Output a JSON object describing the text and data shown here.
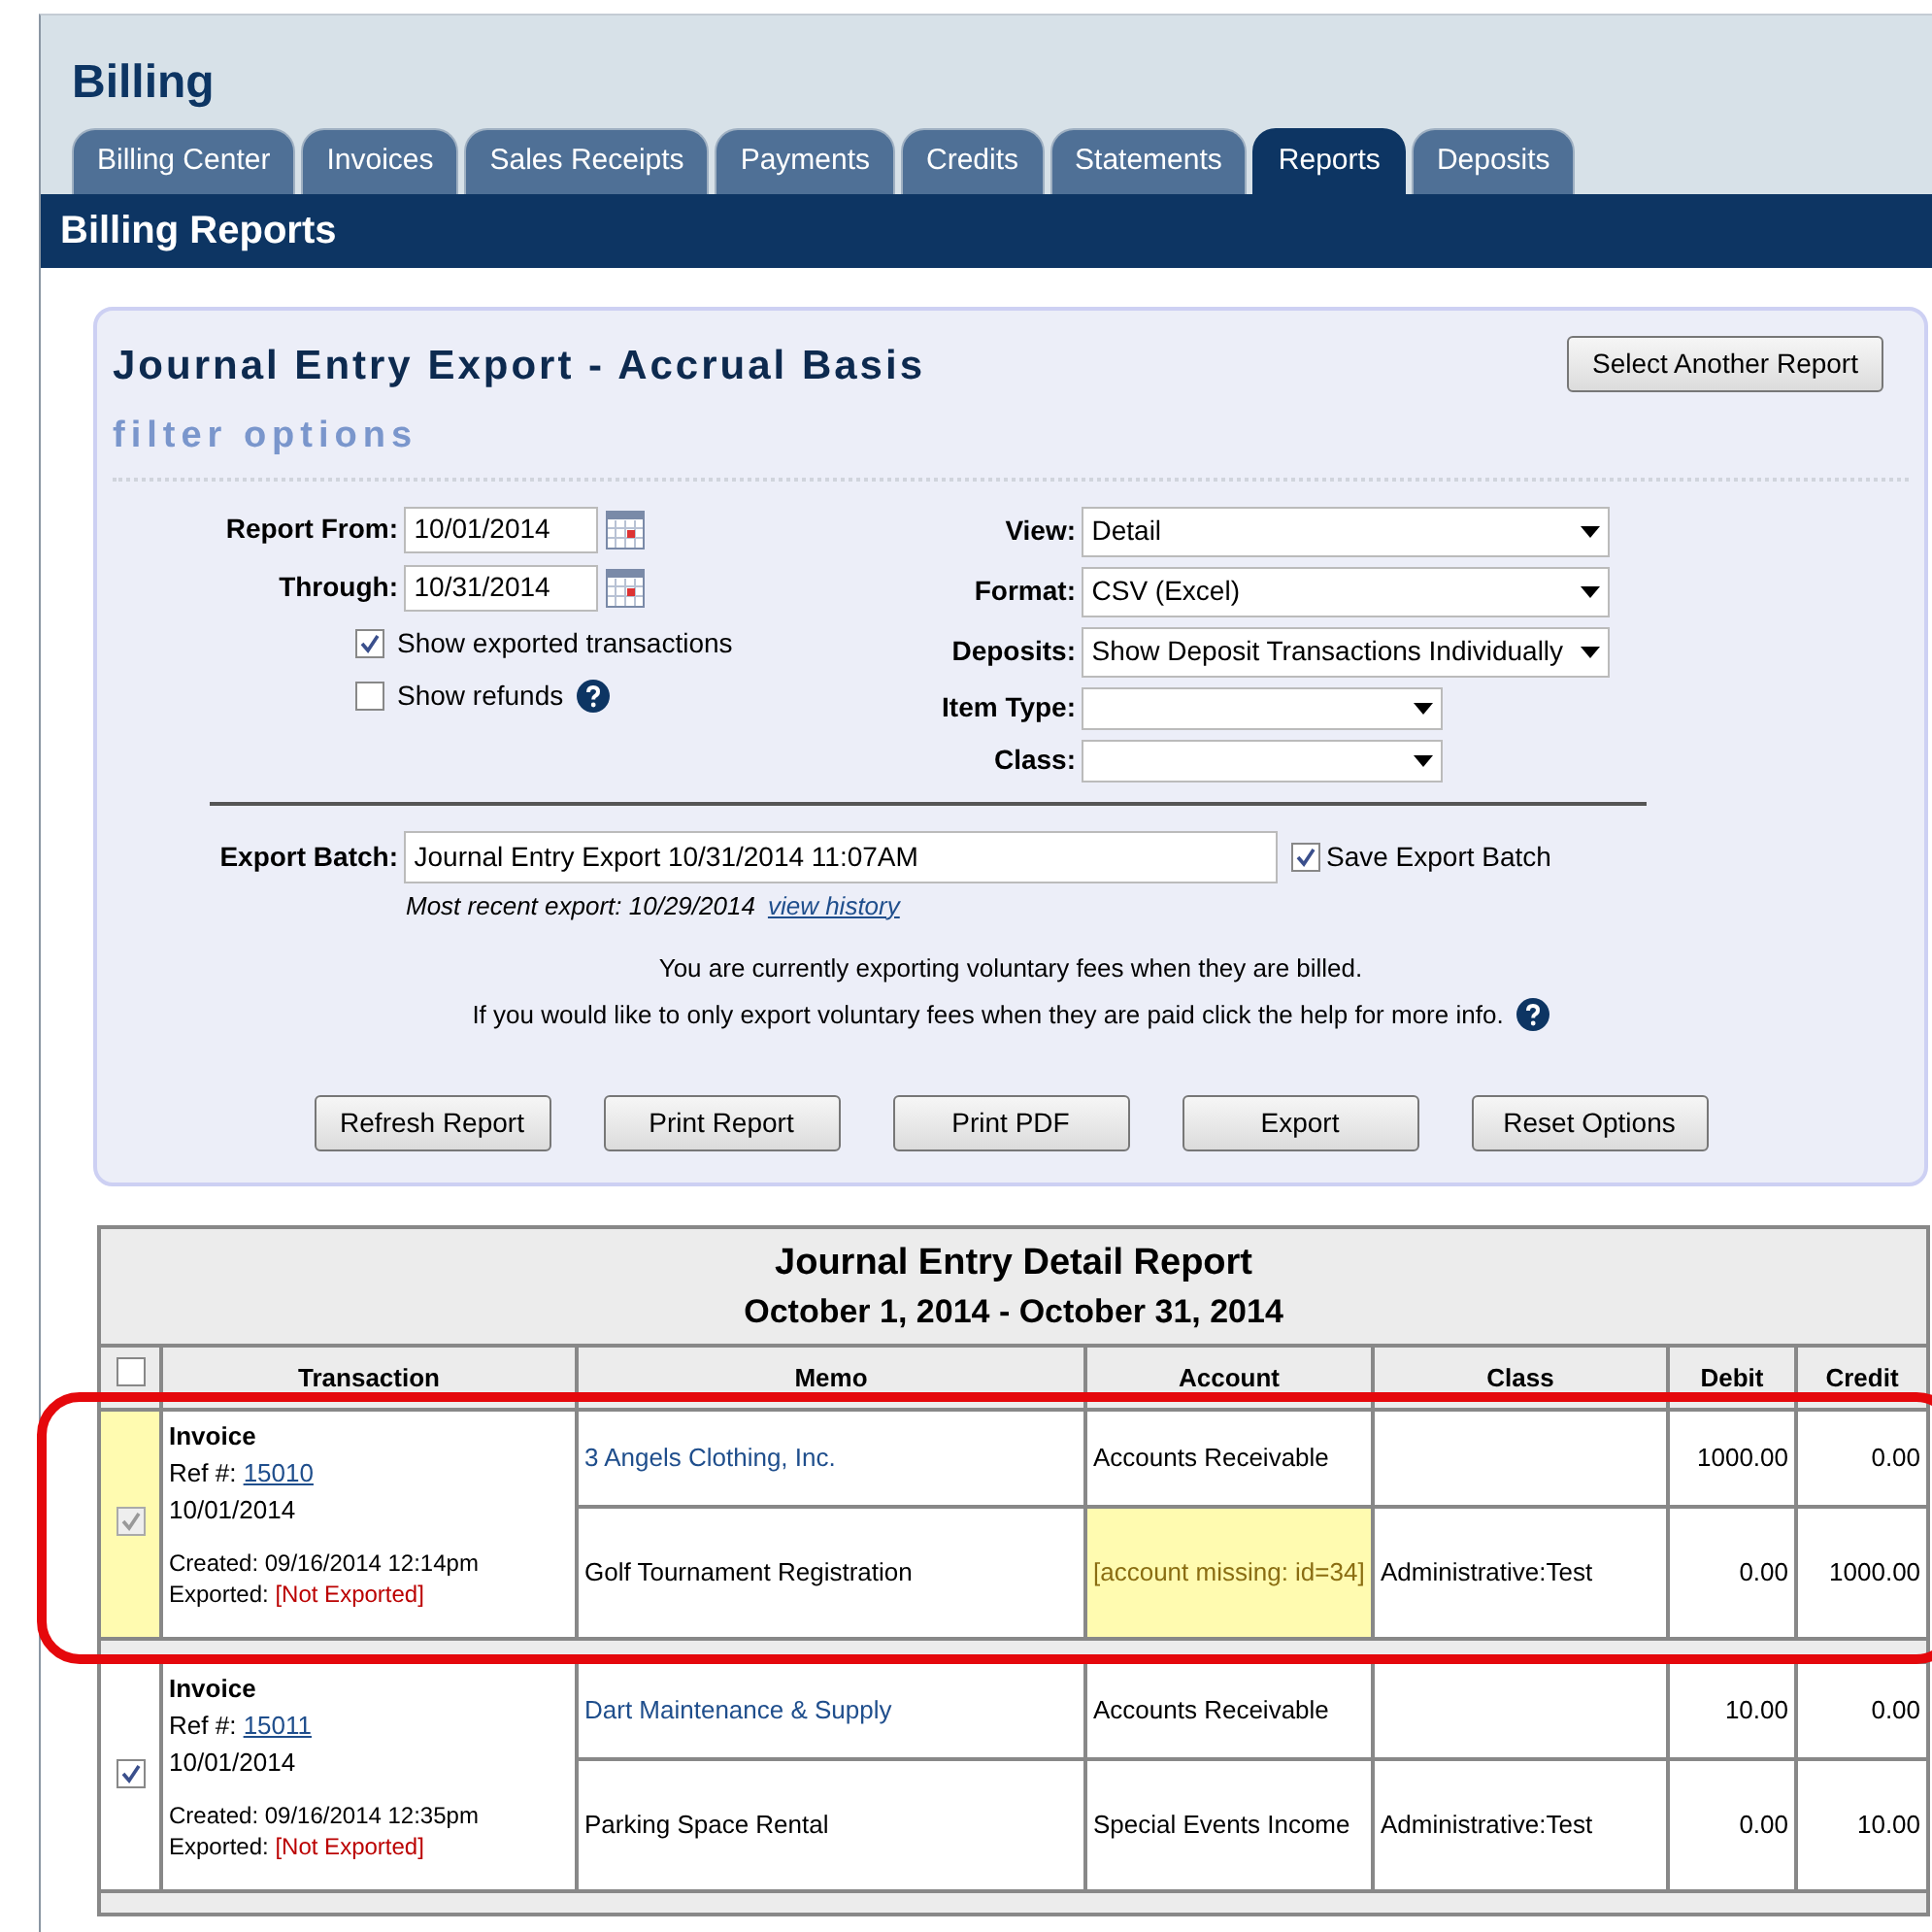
{
  "app_title": "Billing",
  "tabs": [
    {
      "label": "Billing Center",
      "selected": false
    },
    {
      "label": "Invoices",
      "selected": false
    },
    {
      "label": "Sales Receipts",
      "selected": false
    },
    {
      "label": "Payments",
      "selected": false
    },
    {
      "label": "Credits",
      "selected": false
    },
    {
      "label": "Statements",
      "selected": false
    },
    {
      "label": "Reports",
      "selected": true
    },
    {
      "label": "Deposits",
      "selected": false
    }
  ],
  "section_title": "Billing Reports",
  "report": {
    "title": "Journal Entry Export - Accrual Basis",
    "subtitle": "filter options",
    "select_button": "Select Another Report",
    "date_fields": [
      {
        "label": "Report From:",
        "value": "10/01/2014"
      },
      {
        "label": "Through:",
        "value": "10/31/2014"
      }
    ],
    "checkboxes": [
      {
        "label": "Show exported transactions",
        "checked": true,
        "help": false
      },
      {
        "label": "Show refunds",
        "checked": false,
        "help": true
      }
    ],
    "dropdowns": [
      {
        "label": "View:",
        "value": "Detail",
        "wide": true
      },
      {
        "label": "Format:",
        "value": "CSV (Excel)",
        "wide": true
      },
      {
        "label": "Deposits:",
        "value": "Show Deposit Transactions Individually",
        "wide": true
      },
      {
        "label": "Item Type:",
        "wide": false
      },
      {
        "label": "Class:",
        "wide": false
      }
    ],
    "export_batch": {
      "label": "Export Batch:",
      "value": "Journal Entry Export 10/31/2014 11:07AM",
      "save_label": "Save Export Batch",
      "save_checked": true
    },
    "recent_export": "Most recent export: 10/29/2014",
    "history_link": "view history",
    "notes": [
      "You are currently exporting voluntary fees when they are billed.",
      "If you would like to only export voluntary fees when they are paid click the help for more info."
    ],
    "buttons": [
      "Refresh Report",
      "Print Report",
      "Print PDF",
      "Export",
      "Reset Options"
    ]
  },
  "table": {
    "title": "Journal Entry Detail Report",
    "date_range": "October 1, 2014 - October 31, 2014",
    "select_all_checked": false,
    "columns": [
      "Transaction",
      "Memo",
      "Account",
      "Class",
      "Debit",
      "Credit"
    ],
    "groups": [
      {
        "type": "Invoice",
        "ref_label": "Ref #:",
        "ref": "15010",
        "date": "10/01/2014",
        "created": "Created: 09/16/2014 12:14pm",
        "exported_label": "Exported:",
        "exported_status": "[Not Exported]",
        "checked": true,
        "flagged": true,
        "circled": true,
        "lines": [
          {
            "memo": "3 Angels Clothing, Inc.",
            "kind": "customer",
            "account": "Accounts Receivable",
            "account_missing": false,
            "debit": "1000.00",
            "credit": "0.00"
          },
          {
            "memo": "Golf Tournament Registration",
            "kind": "item",
            "account": "[account missing: id=34]",
            "account_missing": true,
            "class": "Administrative:Test",
            "debit": "0.00",
            "credit": "1000.00"
          }
        ]
      },
      {
        "type": "Invoice",
        "ref_label": "Ref #:",
        "ref": "15011",
        "date": "10/01/2014",
        "created": "Created: 09/16/2014 12:35pm",
        "exported_label": "Exported:",
        "exported_status": "[Not Exported]",
        "checked": true,
        "flagged": false,
        "circled": false,
        "lines": [
          {
            "memo": "Dart Maintenance & Supply",
            "kind": "customer",
            "account": "Accounts Receivable",
            "account_missing": false,
            "debit": "10.00",
            "credit": "0.00"
          },
          {
            "memo": "Parking Space Rental",
            "kind": "item",
            "account": "Special Events Income",
            "account_missing": false,
            "class": "Administrative:Test",
            "debit": "0.00",
            "credit": "10.00"
          }
        ]
      }
    ]
  }
}
